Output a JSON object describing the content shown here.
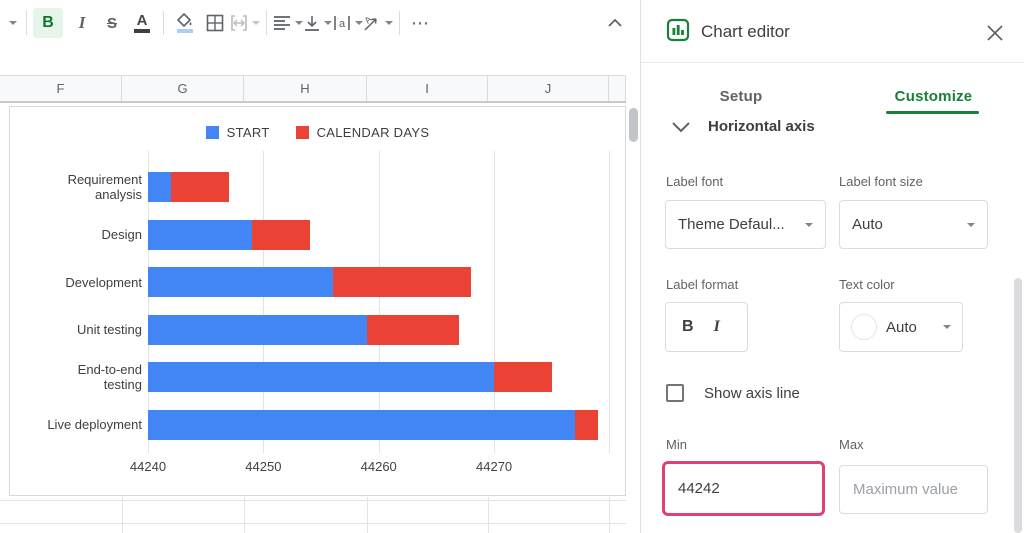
{
  "toolbar": {
    "glyphs": {
      "bold": "B",
      "italic": "I",
      "strikethrough": "S",
      "text_color": "A",
      "wrap_letter": "a",
      "more": "⋯"
    }
  },
  "spreadsheet": {
    "columns": [
      "F",
      "G",
      "H",
      "I",
      "J"
    ]
  },
  "chart_data": {
    "type": "bar",
    "orientation": "horizontal",
    "stacked": true,
    "title": "",
    "legend_position": "top",
    "categories": [
      "Requirement\nanalysis",
      "Design",
      "Development",
      "Unit testing",
      "End-to-end\ntesting",
      "Live deployment"
    ],
    "series": [
      {
        "name": "START",
        "color": "#4285f4",
        "values": [
          44242,
          44249,
          44256,
          44259,
          44270,
          44277
        ],
        "note": "date serial; blue bar spans from axis min to this value"
      },
      {
        "name": "CALENDAR DAYS",
        "color": "#ea4335",
        "values": [
          5,
          5,
          12,
          8,
          5,
          2
        ],
        "note": "duration stacked after START"
      }
    ],
    "x_axis": {
      "min": 44240,
      "max": 44281,
      "ticks": [
        44240,
        44250,
        44260,
        44270
      ],
      "gridlines": [
        44240,
        44250,
        44260,
        44270,
        44280
      ]
    }
  },
  "panel": {
    "title": "Chart editor",
    "tabs": [
      {
        "label": "Setup",
        "active": false
      },
      {
        "label": "Customize",
        "active": true
      }
    ],
    "section": "Horizontal axis",
    "label_font": {
      "label": "Label font",
      "value": "Theme Defaul..."
    },
    "label_font_size": {
      "label": "Label font size",
      "value": "Auto"
    },
    "label_format": {
      "label": "Label format",
      "bold": "B",
      "italic": "I"
    },
    "text_color": {
      "label": "Text color",
      "value": "Auto"
    },
    "show_axis_line": {
      "label": "Show axis line",
      "checked": false
    },
    "min": {
      "label": "Min",
      "value": "44242"
    },
    "max": {
      "label": "Max",
      "placeholder": "Maximum value"
    }
  },
  "colors": {
    "accent_green": "#188038",
    "bar_blue": "#4285f4",
    "bar_red": "#ea4335",
    "focus_pink": "#e0407a",
    "bold_active_bg": "#e6f4ea"
  }
}
